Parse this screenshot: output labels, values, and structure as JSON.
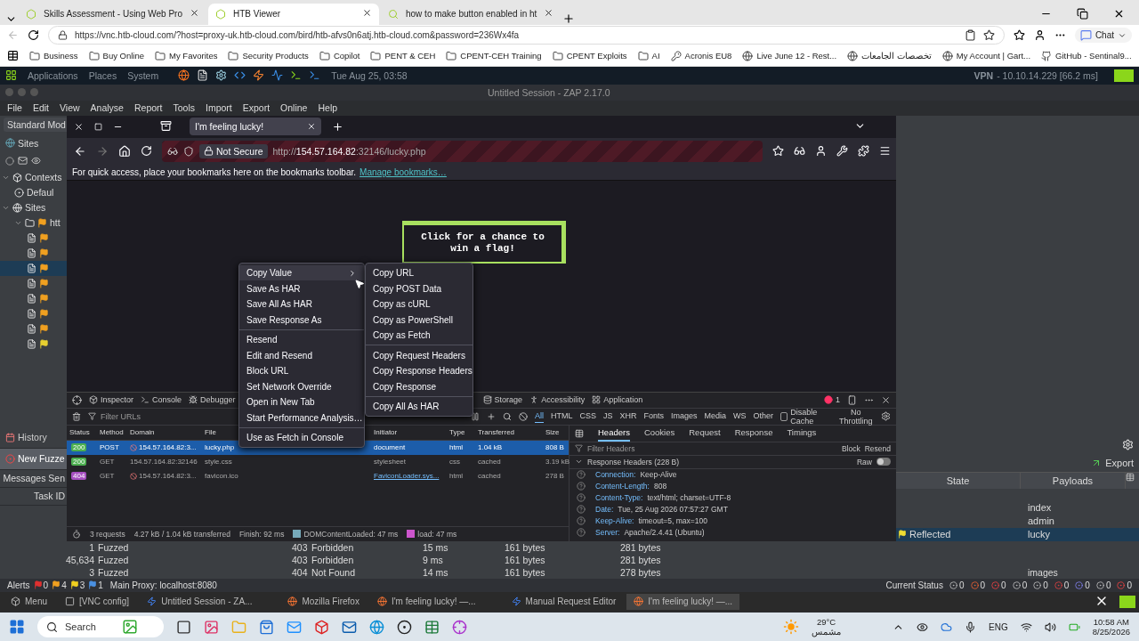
{
  "edge": {
    "tabs": [
      {
        "title": "Skills Assessment - Using Web Pro",
        "selected": false
      },
      {
        "title": "HTB Viewer",
        "selected": true
      },
      {
        "title": "how to make button enabled in ht",
        "selected": false
      }
    ],
    "url": "https://vnc.htb-cloud.com/?host=proxy-uk.htb-cloud.com/bird/htb-afvs0n6atj.htb-cloud.com&password=236Wx4fa",
    "chat": "Chat",
    "bookmarks": [
      {
        "label": "Business",
        "kind": "folder"
      },
      {
        "label": "Buy Online",
        "kind": "folder"
      },
      {
        "label": "My Favorites",
        "kind": "folder"
      },
      {
        "label": "Security Products",
        "kind": "folder"
      },
      {
        "label": "Copilot",
        "kind": "folder"
      },
      {
        "label": "PENT & CEH",
        "kind": "folder"
      },
      {
        "label": "CPENT-CEH Training",
        "kind": "folder"
      },
      {
        "label": "CPENT Exploits",
        "kind": "folder"
      },
      {
        "label": "AI",
        "kind": "folder"
      },
      {
        "label": "Acronis EU8",
        "kind": "key"
      },
      {
        "label": "Live June 12 - Rest...",
        "kind": "site"
      },
      {
        "label": "تخصصات الجامعات",
        "kind": "site"
      },
      {
        "label": "My Account | Gart...",
        "kind": "site"
      },
      {
        "label": "GitHub - Sentinal9...",
        "kind": "github"
      }
    ]
  },
  "desktop_bar": {
    "menus": [
      "Applications",
      "Places",
      "System"
    ],
    "clock": "Tue Aug 25, 03:58",
    "vpn_label": "VPN",
    "vpn_info": "- 10.10.14.229 [66.2 ms]"
  },
  "zap": {
    "title": "Untitled Session - ZAP 2.17.0",
    "menu": [
      "File",
      "Edit",
      "View",
      "Analyse",
      "Report",
      "Tools",
      "Import",
      "Export",
      "Online",
      "Help"
    ],
    "mode": "Standard Mod",
    "sites_tab": "Sites",
    "tree": [
      {
        "kind": "contexts",
        "label": "Contexts",
        "expanded": true,
        "selected": false,
        "children": [
          {
            "kind": "context",
            "label": "Defaul",
            "selected": false
          }
        ]
      },
      {
        "kind": "sites",
        "label": "Sites",
        "expanded": true,
        "selected": false,
        "children": [
          {
            "kind": "site",
            "label": "htt",
            "expanded": true,
            "selected": false,
            "color": "#f0a020",
            "children": [
              {
                "kind": "page",
                "color": "#f0a020",
                "selected": false
              },
              {
                "kind": "page",
                "color": "#f0a020",
                "selected": false
              },
              {
                "kind": "page",
                "color": "#f0a020",
                "selected": true
              },
              {
                "kind": "page",
                "color": "#f0a020",
                "selected": false
              },
              {
                "kind": "page",
                "color": "#f0a020",
                "selected": false
              },
              {
                "kind": "page",
                "color": "#f0a020",
                "selected": false
              },
              {
                "kind": "page",
                "color": "#f0a020",
                "selected": false
              },
              {
                "kind": "page",
                "color": "#e8d030",
                "selected": false
              }
            ]
          }
        ]
      }
    ],
    "lower_tabs": [
      {
        "label": "History",
        "selected": false
      },
      {
        "label": "New Fuzze",
        "selected": true
      }
    ],
    "fuzzer_fields": [
      "Messages Sen",
      "Task ID"
    ],
    "export": "Export",
    "columns": [
      "State",
      "Payloads"
    ],
    "payload_rows": [
      {
        "payload": "index",
        "selected": false
      },
      {
        "payload": "admin",
        "selected": false
      },
      {
        "state": "Reflected",
        "payload": "lucky",
        "selected": true
      }
    ],
    "fuzz_rows": [
      {
        "id": "1",
        "label": "Fuzzed",
        "code": "403",
        "reason": "Forbidden",
        "time": "15 ms",
        "header_size": "161 bytes",
        "body_size": "281 bytes"
      },
      {
        "id": "45,634",
        "label": "Fuzzed",
        "code": "403",
        "reason": "Forbidden",
        "time": "9 ms",
        "header_size": "161 bytes",
        "body_size": "281 bytes"
      },
      {
        "id": "3",
        "label": "Fuzzed",
        "code": "404",
        "reason": "Not Found",
        "time": "14 ms",
        "header_size": "161 bytes",
        "body_size": "278 bytes",
        "payload": "images"
      }
    ],
    "status": {
      "alerts_label": "Alerts",
      "alert_counts": [
        {
          "count": "0",
          "color": "#e03030"
        },
        {
          "count": "4",
          "color": "#f0a020"
        },
        {
          "count": "3",
          "color": "#f0d020"
        },
        {
          "count": "1",
          "color": "#4a90e2"
        }
      ],
      "proxy": "Main Proxy: localhost:8080",
      "current_status": "Current Status",
      "status_counts": [
        "0",
        "0",
        "0",
        "0",
        "0",
        "0",
        "0",
        "0",
        "0"
      ]
    }
  },
  "firefox": {
    "tab": "I'm feeling lucky!",
    "not_secure": "Not Secure",
    "url": "http://**154.57.164.82**:32146/lucky.php",
    "bookmarks_hint": "For quick access, place your bookmarks here on the bookmarks toolbar.",
    "manage_link": "Manage bookmarks…",
    "page_button": "Click for a chance to win a flag!",
    "devtools": {
      "tools": [
        "Inspector",
        "Console",
        "Debugger"
      ],
      "tools_right": [
        "Storage",
        "Accessibility",
        "Application"
      ],
      "error_count": "1",
      "filter_placeholder": "Filter URLs",
      "type_filters": [
        {
          "label": "All",
          "selected": true
        },
        {
          "label": "HTML",
          "selected": false
        },
        {
          "label": "CSS",
          "selected": false
        },
        {
          "label": "JS",
          "selected": false
        },
        {
          "label": "XHR",
          "selected": false
        },
        {
          "label": "Fonts",
          "selected": false
        },
        {
          "label": "Images",
          "selected": false
        },
        {
          "label": "Media",
          "selected": false
        },
        {
          "label": "WS",
          "selected": false
        },
        {
          "label": "Other",
          "selected": false
        }
      ],
      "disable_cache": {
        "label": "Disable Cache",
        "checked": false
      },
      "throttling": "No Throttling",
      "columns": [
        "Status",
        "Method",
        "Domain",
        "File",
        "Initiator",
        "Type",
        "Transferred",
        "Size"
      ],
      "requests": [
        {
          "status": "200",
          "color": "#4caf50",
          "method": "POST",
          "domain": "154.57.164.82:3...",
          "insecure": true,
          "file": "lucky.php",
          "initiator": "document",
          "type": "html",
          "transferred": "1.04 kB",
          "size": "808 B",
          "selected": true
        },
        {
          "status": "200",
          "color": "#4caf50",
          "method": "GET",
          "domain": "154.57.164.82:32146",
          "insecure": false,
          "file": "style.css",
          "initiator": "stylesheet",
          "type": "css",
          "transferred": "cached",
          "size": "3.19 kB",
          "selected": false
        },
        {
          "status": "404",
          "color": "#a64fc0",
          "method": "GET",
          "domain": "154.57.164.82:3...",
          "insecure": true,
          "file": "favicon.ico",
          "initiator": "FaviconLoader.sys...",
          "initiator_link": true,
          "type": "html",
          "transferred": "cached",
          "size": "278 B",
          "selected": false
        }
      ],
      "summary": [
        "3 requests",
        "4.27 kB / 1.04 kB transferred",
        "Finish: 92 ms",
        "DOMContentLoaded: 47 ms",
        "load: 47 ms"
      ],
      "detail_tabs": [
        {
          "label": "Headers",
          "selected": true
        },
        {
          "label": "Cookies",
          "selected": false
        },
        {
          "label": "Request",
          "selected": false
        },
        {
          "label": "Response",
          "selected": false
        },
        {
          "label": "Timings",
          "selected": false
        }
      ],
      "filter_headers": "Filter Headers",
      "block": "Block",
      "resend": "Resend",
      "section": "Response Headers (228 B)",
      "raw": "Raw",
      "raw_on": false,
      "headers": [
        {
          "name": "Connection:",
          "value": "Keep-Alive"
        },
        {
          "name": "Content-Length:",
          "value": "808"
        },
        {
          "name": "Content-Type:",
          "value": "text/html; charset=UTF-8"
        },
        {
          "name": "Date:",
          "value": "Tue, 25 Aug 2026 07:57:27 GMT"
        },
        {
          "name": "Keep-Alive:",
          "value": "timeout=5, max=100"
        },
        {
          "name": "Server:",
          "value": "Apache/2.4.41 (Ubuntu)"
        }
      ]
    },
    "context_menu": {
      "groups": [
        [
          {
            "label": "Copy Value",
            "kind": "submenu",
            "selected": true
          },
          {
            "label": "Save As HAR",
            "kind": "item",
            "selected": false
          },
          {
            "label": "Save All As HAR",
            "kind": "item",
            "selected": false
          },
          {
            "label": "Save Response As",
            "kind": "item",
            "selected": false
          }
        ],
        [
          {
            "label": "Resend",
            "kind": "item",
            "selected": false
          },
          {
            "label": "Edit and Resend",
            "kind": "item",
            "selected": false
          },
          {
            "label": "Block URL",
            "kind": "item",
            "selected": false
          },
          {
            "label": "Set Network Override",
            "kind": "item",
            "selected": false
          },
          {
            "label": "Open in New Tab",
            "kind": "item",
            "selected": false
          },
          {
            "label": "Start Performance Analysis…",
            "kind": "item",
            "selected": false
          }
        ],
        [
          {
            "label": "Use as Fetch in Console",
            "kind": "item",
            "selected": false
          }
        ]
      ],
      "submenu": [
        [
          "Copy URL",
          "Copy POST Data",
          "Copy as cURL",
          "Copy as PowerShell",
          "Copy as Fetch"
        ],
        [
          "Copy Request Headers",
          "Copy Response Headers",
          "Copy Response"
        ],
        [
          "Copy All As HAR"
        ]
      ]
    }
  },
  "vnc_taskbar": [
    {
      "label": "Menu",
      "selected": false
    },
    {
      "label": "[VNC config]",
      "selected": false
    },
    {
      "label": "Untitled Session - ZA...",
      "selected": false
    },
    {
      "label": "Mozilla Firefox",
      "selected": false
    },
    {
      "label": "I'm feeling lucky! —...",
      "selected": false
    },
    {
      "label": "Manual Request Editor",
      "selected": false
    },
    {
      "label": "I'm feeling lucky! —...",
      "selected": true
    }
  ],
  "taskbar": {
    "search": {
      "placeholder": "Search"
    },
    "weather_temp": "29°C",
    "weather_text": "مشمس",
    "lang": "ENG",
    "time": "10:58 AM",
    "date": "8/25/2026"
  }
}
